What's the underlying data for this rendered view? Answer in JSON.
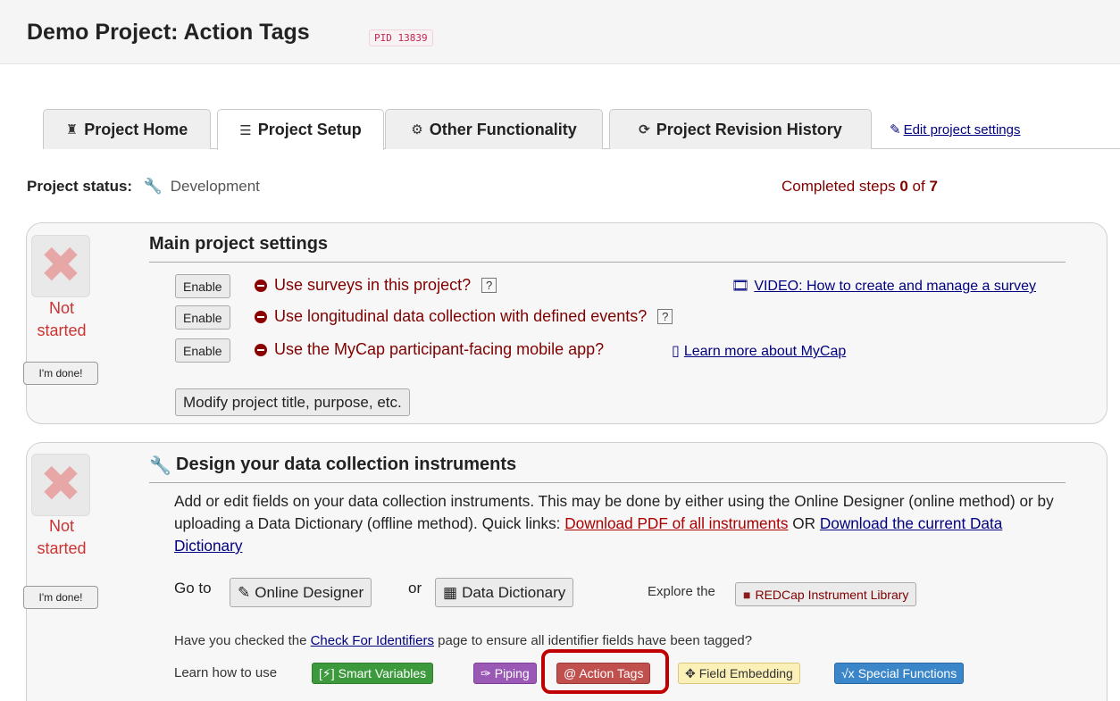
{
  "header": {
    "title": "Demo Project: Action Tags",
    "pid_badge": "PID 13839"
  },
  "tabs": [
    {
      "label": "Project Home",
      "icon": "home-icon"
    },
    {
      "label": "Project Setup",
      "icon": "list-icon"
    },
    {
      "label": "Other Functionality",
      "icon": "gear-icon"
    },
    {
      "label": "Project Revision History",
      "icon": "history-icon"
    }
  ],
  "edit_settings": "Edit project settings",
  "status": {
    "label": "Project status:",
    "value": "Development",
    "steps_prefix": "Completed steps",
    "steps_done": "0",
    "steps_of": "of",
    "steps_total": "7"
  },
  "step_status": {
    "not": "Not",
    "started": "started",
    "done_button": "I'm done!"
  },
  "main_settings": {
    "title": "Main project settings",
    "enable_label": "Enable",
    "q_surveys": "Use surveys in this project?",
    "q_longitudinal": "Use longitudinal data collection with defined events?",
    "q_mycap": "Use the MyCap participant-facing mobile app?",
    "help": "?",
    "video_link": "VIDEO: How to create and manage a survey",
    "mycap_link": "Learn more about MyCap",
    "modify_button": "Modify project title, purpose, etc."
  },
  "design": {
    "title": "Design your data collection instruments",
    "desc_text": "Add or edit fields on your data collection instruments. This may be done by either using the Online Designer (online method) or by uploading a Data Dictionary (offline method). Quick links: ",
    "link_pdf": "Download PDF of all instruments",
    "or_text": " OR ",
    "link_dd": "Download the current Data Dictionary",
    "goto": "Go to",
    "online_designer": "Online Designer",
    "or": "or",
    "data_dictionary": "Data Dictionary",
    "explore": "Explore the",
    "library": "REDCap Instrument Library",
    "check_prefix": "Have you checked the ",
    "check_link": "Check For Identifiers",
    "check_suffix": " page to ensure all identifier fields have been tagged?",
    "learn": "Learn how to use",
    "tags": {
      "smart": "Smart Variables",
      "piping": "Piping",
      "action": "@ Action Tags",
      "embed": "Field Embedding",
      "special": "Special Functions"
    }
  },
  "colors": {
    "accent_red": "#800000",
    "link_blue": "#000080",
    "highlight": "#c00000"
  }
}
